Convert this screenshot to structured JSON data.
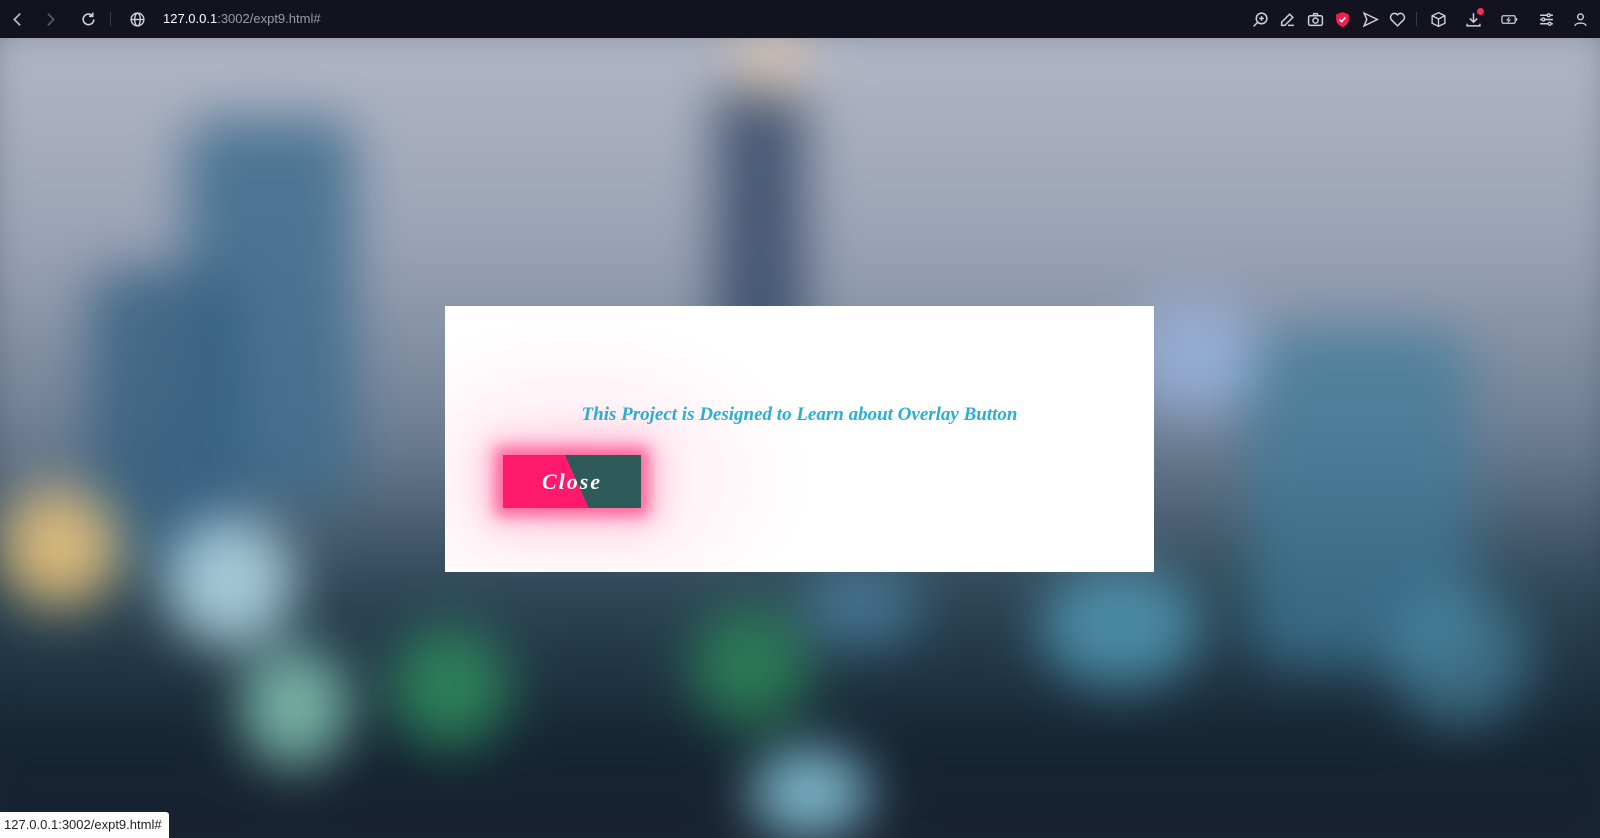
{
  "browser": {
    "url_host": "127.0.0.1",
    "url_path": ":3002/expt9.html#",
    "icons": {
      "back": "arrow-left-icon",
      "forward": "arrow-right-icon",
      "reload": "reload-icon",
      "site_info": "globe-icon",
      "zoom": "zoom-in-icon",
      "edit": "pencil-icon",
      "screenshot": "camera-icon",
      "shield": "shield-icon",
      "send": "send-icon",
      "favorite": "heart-icon",
      "extensions": "cube-icon",
      "downloads": "download-icon",
      "battery": "battery-icon",
      "settings": "sliders-icon",
      "profile": "user-icon"
    },
    "colors": {
      "bar_bg": "#13131f",
      "shield_red": "#f21d4b",
      "badge_red": "#ff2a55"
    }
  },
  "dialog": {
    "message": "This Project is Designed to Learn about Overlay Button",
    "close_label": "Close",
    "colors": {
      "text": "#2aaed6",
      "button_pink": "#fe1a6b",
      "button_teal": "#2e5b59"
    }
  },
  "status_bar": {
    "text": "127.0.0.1:3002/expt9.html#"
  }
}
